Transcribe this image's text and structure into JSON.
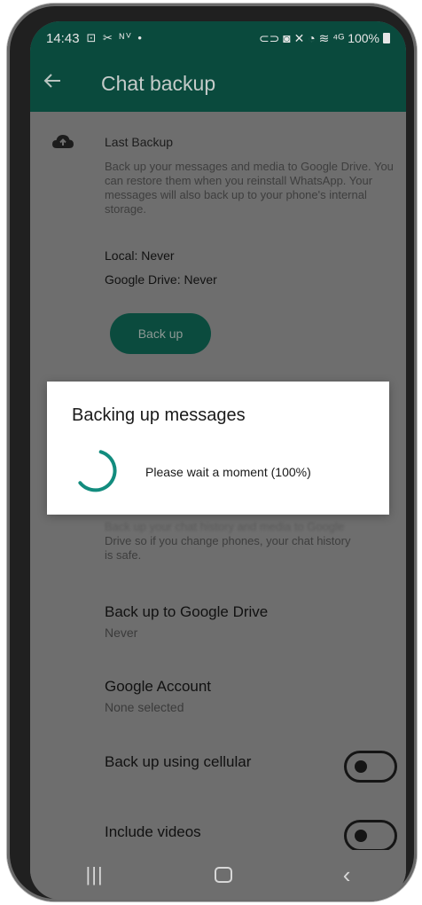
{
  "status_bar": {
    "time": "14:43",
    "left_icons": "⊡ ✂ ᴺⱽ •",
    "right_icons": "⊂⊃ ◙ ✕ ◔ ≋ ⁴ᴳ",
    "battery": "100%"
  },
  "app_bar": {
    "title": "Chat backup",
    "back_icon": "arrow-left"
  },
  "last_backup": {
    "heading": "Last Backup",
    "description": "Back up your messages and media to Google Drive. You can restore them when you reinstall WhatsApp. Your messages will also back up to your phone's internal storage.",
    "local": "Local: Never",
    "google_drive": "Google Drive: Never",
    "backup_button": "Back up"
  },
  "obscured_text": {
    "line1": "Back up your chat history and media to Google",
    "line2": "Drive so if you change phones, your chat history",
    "line3": "is safe."
  },
  "settings": {
    "backup_to_drive": {
      "title": "Back up to Google Drive",
      "value": "Never"
    },
    "google_account": {
      "title": "Google Account",
      "value": "None selected"
    },
    "cellular": {
      "title": "Back up using cellular",
      "enabled": false
    },
    "videos": {
      "title": "Include videos",
      "enabled": false
    }
  },
  "dialog": {
    "title": "Backing up messages",
    "message": "Please wait a moment (100%)",
    "progress_percent": 100
  },
  "nav_bar": {
    "recents": "|||",
    "back": "‹"
  },
  "colors": {
    "app_bar_dimmed": "#0a4a3d",
    "accent_green": "#128c7e",
    "scrim_gray": "#6e6e6e",
    "dialog_bg": "#ffffff"
  }
}
